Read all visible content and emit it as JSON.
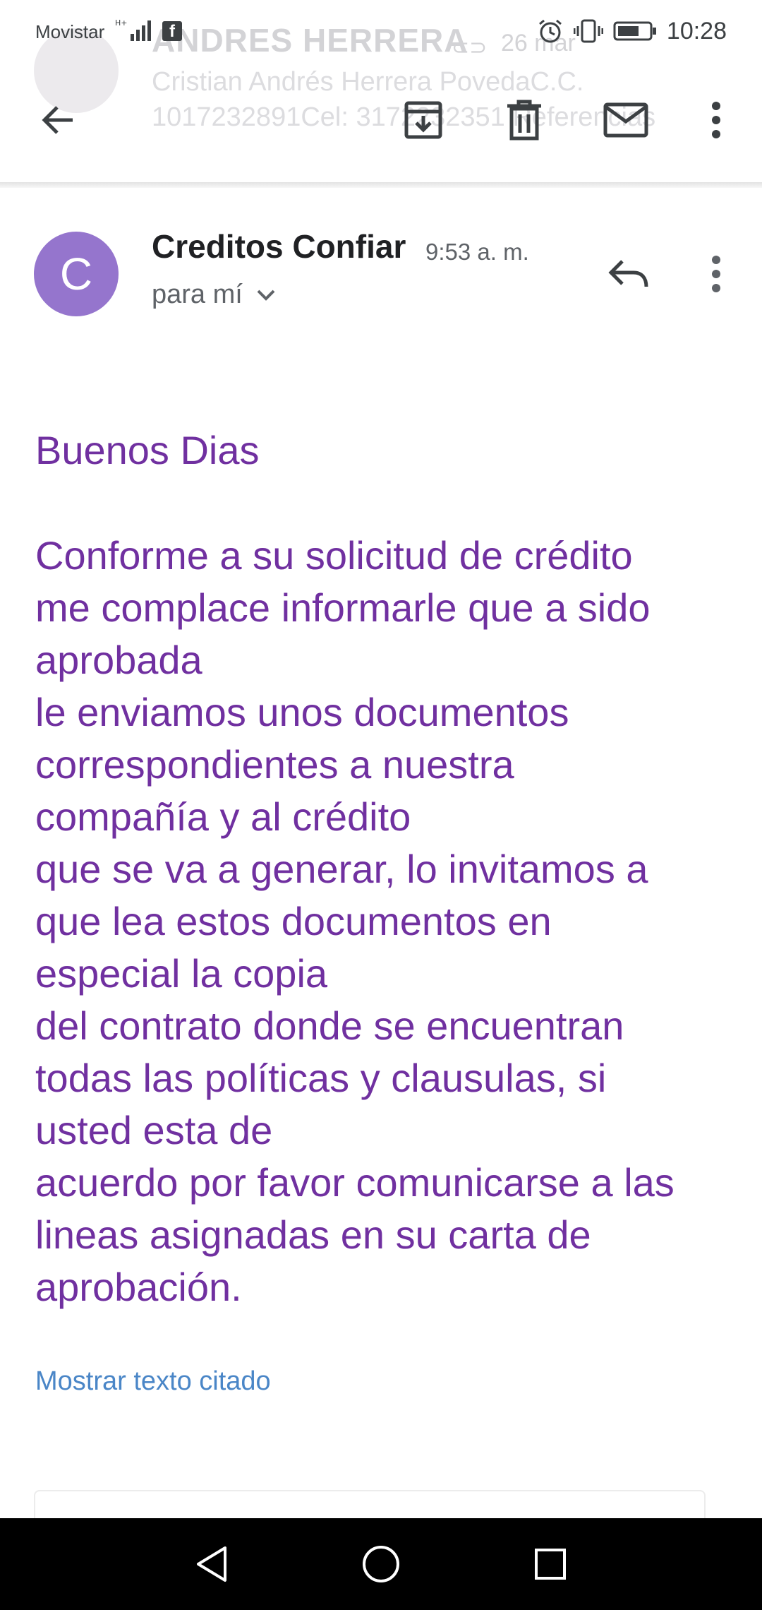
{
  "status_bar": {
    "carrier": "Movistar",
    "network": "H+",
    "time": "10:28",
    "battery_level": 0.7
  },
  "background_header": {
    "sender_name": "ANDRES HERRERA",
    "date": "26 mar",
    "preview_line1": "Cristian Andrés Herrera PovedaC.C.",
    "preview_line2": "1017232891Cel: 3172232351 Referencias"
  },
  "toolbar": {
    "icons": [
      "back-arrow-icon",
      "archive-icon",
      "delete-icon",
      "mark-unread-icon",
      "more-vert-icon"
    ]
  },
  "message": {
    "avatar_letter": "C",
    "avatar_color": "#9575cd",
    "sender": "Creditos Confiar",
    "time": "9:53 a. m.",
    "recipient": "para mí",
    "greeting": "Buenos Dias",
    "body_lines": [
      "Conforme a su solicitud de crédito",
      "me complace informarle que a sido",
      "aprobada",
      "le enviamos unos documentos",
      "correspondientes a nuestra",
      "compañía y al crédito",
      "que se va a generar, lo invitamos a",
      "que lea estos documentos en",
      "especial la copia",
      "del contrato donde se encuentran",
      "todas las políticas y clausulas, si",
      "usted esta de",
      "acuerdo por favor comunicarse a las",
      "lineas asignadas en su carta de",
      "aprobación."
    ],
    "body_color": "#7030a0",
    "show_quoted": "Mostrar texto citado",
    "link_color": "#4a86c7"
  },
  "nav_bar": {
    "icons": [
      "back-triangle-icon",
      "home-circle-icon",
      "recents-square-icon"
    ]
  }
}
